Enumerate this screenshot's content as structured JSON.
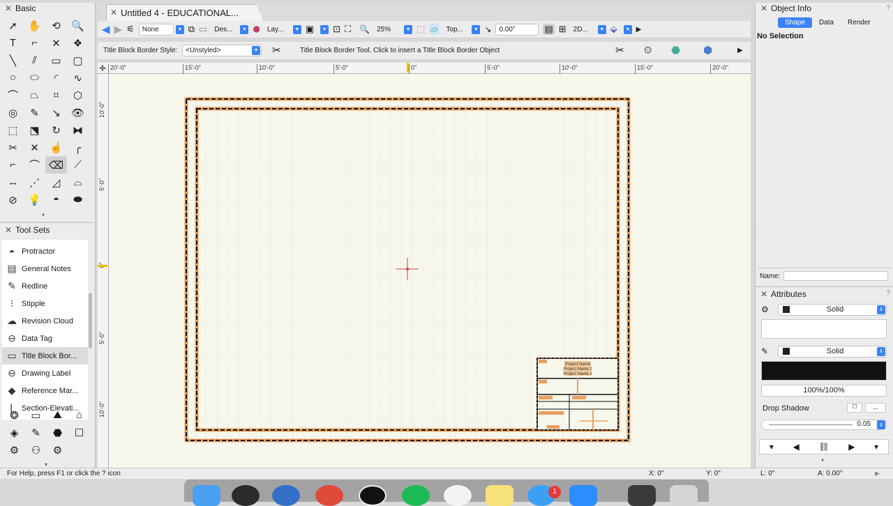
{
  "document": {
    "tab_title": "Untitled 4 - EDUCATIONAL..."
  },
  "basic_palette": {
    "title": "Basic",
    "tools": [
      {
        "icon": "selection-arrow-icon",
        "glyph": "➚"
      },
      {
        "icon": "pan-hand-icon",
        "glyph": "✋"
      },
      {
        "icon": "flyover-icon",
        "glyph": "⟲"
      },
      {
        "icon": "zoom-icon",
        "glyph": "🔍"
      },
      {
        "icon": "text-icon",
        "glyph": "T"
      },
      {
        "icon": "callout-icon",
        "glyph": "⌐"
      },
      {
        "icon": "locus-icon",
        "glyph": "✕"
      },
      {
        "icon": "symbol-insert-icon",
        "glyph": "❖"
      },
      {
        "icon": "line-icon",
        "glyph": "╲"
      },
      {
        "icon": "double-line-icon",
        "glyph": "⫽"
      },
      {
        "icon": "rectangle-icon",
        "glyph": "▭"
      },
      {
        "icon": "rounded-rectangle-icon",
        "glyph": "▢"
      },
      {
        "icon": "circle-icon",
        "glyph": "○"
      },
      {
        "icon": "oval-icon",
        "glyph": "⬭"
      },
      {
        "icon": "arc-icon",
        "glyph": "◜"
      },
      {
        "icon": "freehand-icon",
        "glyph": "∿"
      },
      {
        "icon": "polyline-icon",
        "glyph": "⌒"
      },
      {
        "icon": "polygon-icon",
        "glyph": "⏢"
      },
      {
        "icon": "double-line-polygon-icon",
        "glyph": "⌗"
      },
      {
        "icon": "regular-polygon-icon",
        "glyph": "⬡"
      },
      {
        "icon": "spiral-icon",
        "glyph": "◎"
      },
      {
        "icon": "eyedropper-icon",
        "glyph": "✎"
      },
      {
        "icon": "attribute-mapping-icon",
        "glyph": "↘"
      },
      {
        "icon": "visibility-icon",
        "glyph": "👁"
      },
      {
        "icon": "reshape-icon",
        "glyph": "⬚"
      },
      {
        "icon": "offset-icon",
        "glyph": "⬔"
      },
      {
        "icon": "rotate-icon",
        "glyph": "↻"
      },
      {
        "icon": "mirror-icon",
        "glyph": "⧓"
      },
      {
        "icon": "trim-icon",
        "glyph": "✂"
      },
      {
        "icon": "split-icon",
        "glyph": "✕"
      },
      {
        "icon": "connect-icon",
        "glyph": "☝"
      },
      {
        "icon": "fillet-icon",
        "glyph": "╭"
      },
      {
        "icon": "chamfer-icon",
        "glyph": "⌐"
      },
      {
        "icon": "clip-icon",
        "glyph": "⌒"
      },
      {
        "icon": "eraser-icon",
        "glyph": "⌫",
        "selected": true
      },
      {
        "icon": "extend-icon",
        "glyph": "⟋"
      },
      {
        "icon": "dimension-icon",
        "glyph": "↔"
      },
      {
        "icon": "angular-dimension-icon",
        "glyph": "⋰"
      },
      {
        "icon": "bezier-icon",
        "glyph": "◿"
      },
      {
        "icon": "stamp-icon",
        "glyph": "⌓"
      },
      {
        "icon": "clock-icon",
        "glyph": "⊘"
      },
      {
        "icon": "light-icon",
        "glyph": "💡"
      },
      {
        "icon": "protractor-tool-icon",
        "glyph": "◓"
      },
      {
        "icon": "detail-icon",
        "glyph": "⬬"
      }
    ]
  },
  "tool_sets": {
    "title": "Tool Sets",
    "items": [
      {
        "label": "Protractor",
        "icon": "protractor-icon",
        "glyph": "◓"
      },
      {
        "label": "General Notes",
        "icon": "general-notes-icon",
        "glyph": "▤"
      },
      {
        "label": "Redline",
        "icon": "redline-icon",
        "glyph": "✎"
      },
      {
        "label": "Stipple",
        "icon": "stipple-icon",
        "glyph": "⁝"
      },
      {
        "label": "Revision Cloud",
        "icon": "revision-cloud-icon",
        "glyph": "☁"
      },
      {
        "label": "Data Tag",
        "icon": "data-tag-icon",
        "glyph": "⊖"
      },
      {
        "label": "Title Block Bor...",
        "icon": "title-block-border-icon",
        "glyph": "▭",
        "selected": true
      },
      {
        "label": "Drawing Label",
        "icon": "drawing-label-icon",
        "glyph": "⊖"
      },
      {
        "label": "Reference Mar...",
        "icon": "reference-marker-icon",
        "glyph": "◆"
      },
      {
        "label": "Section-Elevati...",
        "icon": "section-elevation-icon",
        "glyph": "⌊"
      }
    ],
    "set_icons": [
      "building-shell-icon",
      "site-planning-icon",
      "landscape-icon",
      "furniture-icon",
      "visualization-icon",
      "detailing-icon",
      "machine-design-icon",
      "dims-notes-icon",
      "spotlight-icon",
      "networking-icon",
      "custom-settings-icon"
    ]
  },
  "view_bar": {
    "class": "None",
    "design_layer": "Des...",
    "layer": "Lay...",
    "zoom": "25%",
    "view": "Top...",
    "rotation": "0.00°",
    "render_mode": "2D..."
  },
  "mode_bar": {
    "style_label": "Title Block Border Style:",
    "style_value": "<Unstyled>",
    "hint": "Title Block Border Tool. Click to insert a Title Block Border Object"
  },
  "h_ruler_labels": [
    "20'-0\"",
    "15'-0\"",
    "10'-0\"",
    "5'-0\"",
    "0\"",
    "5'-0\"",
    "10'-0\"",
    "15'-0\"",
    "20'-0\""
  ],
  "v_ruler_labels": [
    "10'-0\"",
    "5'-0\"",
    "0\"",
    "5'-0\"",
    "10'-0\""
  ],
  "title_block": {
    "name_1": "Project Name",
    "name_2": "Project Name 2",
    "name_3": "Project Name 3"
  },
  "object_info": {
    "title": "Object Info",
    "tabs": [
      "Shape",
      "Data",
      "Render"
    ],
    "selection": "No Selection",
    "name_label": "Name:"
  },
  "attributes": {
    "title": "Attributes",
    "fill_style": "Solid",
    "pen_style": "Solid",
    "opacity": "100%/100%",
    "drop_shadow": "Drop Shadow",
    "shadow_more": "...",
    "line_weight": "0.05"
  },
  "status_bar": {
    "help": "For Help, press F1 or click the ? icon",
    "x": "X: 0\"",
    "y": "Y: 0\"",
    "l": "L: 0\"",
    "a": "A: 0.00°"
  },
  "dock": {
    "badge": "1",
    "apps": [
      "finder-icon",
      "system-preferences-icon",
      "safari-icon",
      "chrome-icon",
      "vectorworks-icon",
      "spotify-icon",
      "photos-icon",
      "notes-icon",
      "messages-icon",
      "zoom-app-icon",
      "folder-stack-icon",
      "trash-icon"
    ]
  },
  "colors": {
    "accent": "#3b82f6",
    "canvas": "#f7f7ec",
    "border_orange": "#e8a060",
    "crosshair": "#d04040"
  }
}
